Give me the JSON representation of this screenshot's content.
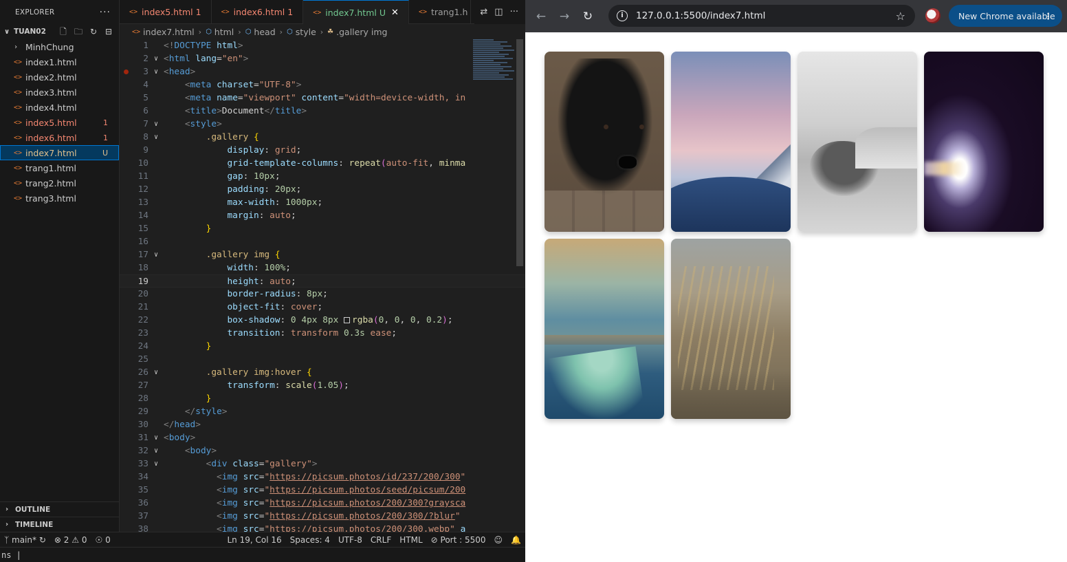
{
  "explorer": {
    "title": "EXPLORER",
    "folder": "TUAN02",
    "items": [
      {
        "label": "MinhChung",
        "type": "folder",
        "badge": "",
        "state": "normal"
      },
      {
        "label": "index1.html",
        "type": "file",
        "badge": "",
        "state": "normal"
      },
      {
        "label": "index2.html",
        "type": "file",
        "badge": "",
        "state": "normal"
      },
      {
        "label": "index3.html",
        "type": "file",
        "badge": "",
        "state": "normal"
      },
      {
        "label": "index4.html",
        "type": "file",
        "badge": "",
        "state": "normal"
      },
      {
        "label": "index5.html",
        "type": "file",
        "badge": "1",
        "state": "err"
      },
      {
        "label": "index6.html",
        "type": "file",
        "badge": "1",
        "state": "err"
      },
      {
        "label": "index7.html",
        "type": "file",
        "badge": "U",
        "state": "active"
      },
      {
        "label": "trang1.html",
        "type": "file",
        "badge": "",
        "state": "normal"
      },
      {
        "label": "trang2.html",
        "type": "file",
        "badge": "",
        "state": "normal"
      },
      {
        "label": "trang3.html",
        "type": "file",
        "badge": "",
        "state": "normal"
      }
    ],
    "outline": "OUTLINE",
    "timeline": "TIMELINE"
  },
  "tabs": [
    {
      "label": "index5.html",
      "badge": "1",
      "state": "err"
    },
    {
      "label": "index6.html",
      "badge": "1",
      "state": "err"
    },
    {
      "label": "index7.html",
      "badge": "U",
      "state": "active"
    },
    {
      "label": "trang1.h",
      "badge": "",
      "state": "normal"
    }
  ],
  "breadcrumb": [
    "index7.html",
    "html",
    "head",
    "style",
    ".gallery img"
  ],
  "code_lines": [
    {
      "n": "1",
      "fold": "",
      "html": "<span class='t-tag'>&lt;!</span><span class='t-tn'>DOCTYPE</span> <span class='t-at'>html</span><span class='t-tag'>&gt;</span>"
    },
    {
      "n": "2",
      "fold": "v",
      "html": "<span class='t-tag'>&lt;</span><span class='t-tn'>html</span> <span class='t-at'>lang</span>=<span class='t-str'>\"en\"</span><span class='t-tag'>&gt;</span>"
    },
    {
      "n": "3",
      "fold": "v",
      "bp": true,
      "html": "<span class='t-tag'>&lt;</span><span class='t-tn'>head</span><span class='t-tag'>&gt;</span>"
    },
    {
      "n": "4",
      "fold": "",
      "html": "    <span class='t-tag'>&lt;</span><span class='t-tn'>meta</span> <span class='t-at'>charset</span>=<span class='t-str'>\"UTF-8\"</span><span class='t-tag'>&gt;</span>"
    },
    {
      "n": "5",
      "fold": "",
      "html": "    <span class='t-tag'>&lt;</span><span class='t-tn'>meta</span> <span class='t-at'>name</span>=<span class='t-str'>\"viewport\"</span> <span class='t-at'>content</span>=<span class='t-str'>\"width=device-width, in</span>"
    },
    {
      "n": "6",
      "fold": "",
      "html": "    <span class='t-tag'>&lt;</span><span class='t-tn'>title</span><span class='t-tag'>&gt;</span>Document<span class='t-tag'>&lt;/</span><span class='t-tn'>title</span><span class='t-tag'>&gt;</span>"
    },
    {
      "n": "7",
      "fold": "v",
      "html": "    <span class='t-tag'>&lt;</span><span class='t-tn'>style</span><span class='t-tag'>&gt;</span>"
    },
    {
      "n": "8",
      "fold": "v",
      "html": "        <span class='t-sel'>.gallery</span> <span class='t-br'>{</span>"
    },
    {
      "n": "9",
      "fold": "",
      "html": "            <span class='t-pr'>display</span>: <span class='t-val'>grid</span>;"
    },
    {
      "n": "10",
      "fold": "",
      "html": "            <span class='t-pr'>grid-template-columns</span>: <span class='t-fn'>repeat</span><span class='t-br2'>(</span><span class='t-val'>auto-fit</span>, <span class='t-fn'>minma</span>"
    },
    {
      "n": "11",
      "fold": "",
      "html": "            <span class='t-pr'>gap</span>: <span class='t-num'>10px</span>;"
    },
    {
      "n": "12",
      "fold": "",
      "html": "            <span class='t-pr'>padding</span>: <span class='t-num'>20px</span>;"
    },
    {
      "n": "13",
      "fold": "",
      "html": "            <span class='t-pr'>max-width</span>: <span class='t-num'>1000px</span>;"
    },
    {
      "n": "14",
      "fold": "",
      "html": "            <span class='t-pr'>margin</span>: <span class='t-val'>auto</span>;"
    },
    {
      "n": "15",
      "fold": "",
      "html": "        <span class='t-br'>}</span>"
    },
    {
      "n": "16",
      "fold": "",
      "html": ""
    },
    {
      "n": "17",
      "fold": "v",
      "html": "        <span class='t-sel'>.gallery img</span> <span class='t-br'>{</span>"
    },
    {
      "n": "18",
      "fold": "",
      "html": "            <span class='t-pr'>width</span>: <span class='t-num'>100%</span>;"
    },
    {
      "n": "19",
      "fold": "",
      "current": true,
      "html": "            <span class='t-pr'>height</span>: <span class='t-val'>auto</span>;"
    },
    {
      "n": "20",
      "fold": "",
      "html": "            <span class='t-pr'>border-radius</span>: <span class='t-num'>8px</span>;"
    },
    {
      "n": "21",
      "fold": "",
      "html": "            <span class='t-pr'>object-fit</span>: <span class='t-val'>cover</span>;"
    },
    {
      "n": "22",
      "fold": "",
      "html": "            <span class='t-pr'>box-shadow</span>: <span class='t-num'>0</span> <span class='t-num'>4px</span> <span class='t-num'>8px</span> <span class='sw'></span><span class='t-fn'>rgba</span><span class='t-br2'>(</span><span class='t-num'>0</span>, <span class='t-num'>0</span>, <span class='t-num'>0</span>, <span class='t-num'>0.2</span><span class='t-br2'>)</span>;"
    },
    {
      "n": "23",
      "fold": "",
      "html": "            <span class='t-pr'>transition</span>: <span class='t-val'>transform</span> <span class='t-num'>0.3s</span> <span class='t-val'>ease</span>;"
    },
    {
      "n": "24",
      "fold": "",
      "html": "        <span class='t-br'>}</span>"
    },
    {
      "n": "25",
      "fold": "",
      "html": ""
    },
    {
      "n": "26",
      "fold": "v",
      "html": "        <span class='t-sel'>.gallery img:hover</span> <span class='t-br'>{</span>"
    },
    {
      "n": "27",
      "fold": "",
      "html": "            <span class='t-pr'>transform</span>: <span class='t-fn'>scale</span><span class='t-br2'>(</span><span class='t-num'>1.05</span><span class='t-br2'>)</span>;"
    },
    {
      "n": "28",
      "fold": "",
      "html": "        <span class='t-br'>}</span>"
    },
    {
      "n": "29",
      "fold": "",
      "html": "    <span class='t-tag'>&lt;/</span><span class='t-tn'>style</span><span class='t-tag'>&gt;</span>"
    },
    {
      "n": "30",
      "fold": "",
      "html": "<span class='t-tag'>&lt;/</span><span class='t-tn'>head</span><span class='t-tag'>&gt;</span>"
    },
    {
      "n": "31",
      "fold": "v",
      "html": "<span class='t-tag'>&lt;</span><span class='t-tn'>body</span><span class='t-tag'>&gt;</span>"
    },
    {
      "n": "32",
      "fold": "v",
      "html": "    <span class='t-tag'>&lt;</span><span class='t-tn'>body</span><span class='t-tag'>&gt;</span>"
    },
    {
      "n": "33",
      "fold": "v",
      "html": "        <span class='t-tag'>&lt;</span><span class='t-tn'>div</span> <span class='t-at'>class</span>=<span class='t-str'>\"gallery\"</span><span class='t-tag'>&gt;</span>"
    },
    {
      "n": "34",
      "fold": "",
      "html": "          <span class='t-tag'>&lt;</span><span class='t-tn'>img</span> <span class='t-at'>src</span>=<span class='t-str'>\"</span><span class='t-url'>https://picsum.photos/id/237/200/300</span><span class='t-str'>\"</span>"
    },
    {
      "n": "35",
      "fold": "",
      "html": "          <span class='t-tag'>&lt;</span><span class='t-tn'>img</span> <span class='t-at'>src</span>=<span class='t-str'>\"</span><span class='t-url'>https://picsum.photos/seed/picsum/200</span>"
    },
    {
      "n": "36",
      "fold": "",
      "html": "          <span class='t-tag'>&lt;</span><span class='t-tn'>img</span> <span class='t-at'>src</span>=<span class='t-str'>\"</span><span class='t-url'>https://picsum.photos/200/300?graysca</span>"
    },
    {
      "n": "37",
      "fold": "",
      "html": "          <span class='t-tag'>&lt;</span><span class='t-tn'>img</span> <span class='t-at'>src</span>=<span class='t-str'>\"</span><span class='t-url'>https://picsum.photos/200/300/?blur</span><span class='t-str'>\"</span>"
    },
    {
      "n": "38",
      "fold": "",
      "html": "          <span class='t-tag'>&lt;</span><span class='t-tn'>img</span> <span class='t-at'>src</span>=<span class='t-str'>\"</span><span class='t-url'>https://picsum.photos/200/300.webp</span><span class='t-str'>\"</span> <span class='t-at'>a</span>"
    }
  ],
  "statusbar": {
    "branch": "main*",
    "errors": "2",
    "warnings": "0",
    "ports": "0",
    "position": "Ln 19, Col 16",
    "spaces": "Spaces: 4",
    "encoding": "UTF-8",
    "eol": "CRLF",
    "language": "HTML",
    "port": "Port : 5500"
  },
  "panel_strip": "ns  |",
  "browser": {
    "url": "127.0.0.1:5500/index7.html",
    "update_label": "New Chrome available",
    "photos": [
      {
        "name": "photo-puppy"
      },
      {
        "name": "photo-mountain-sky"
      },
      {
        "name": "photo-yak-grayscale"
      },
      {
        "name": "photo-blurred-light"
      },
      {
        "name": "photo-sea-wake"
      },
      {
        "name": "photo-wheat-field"
      }
    ]
  }
}
